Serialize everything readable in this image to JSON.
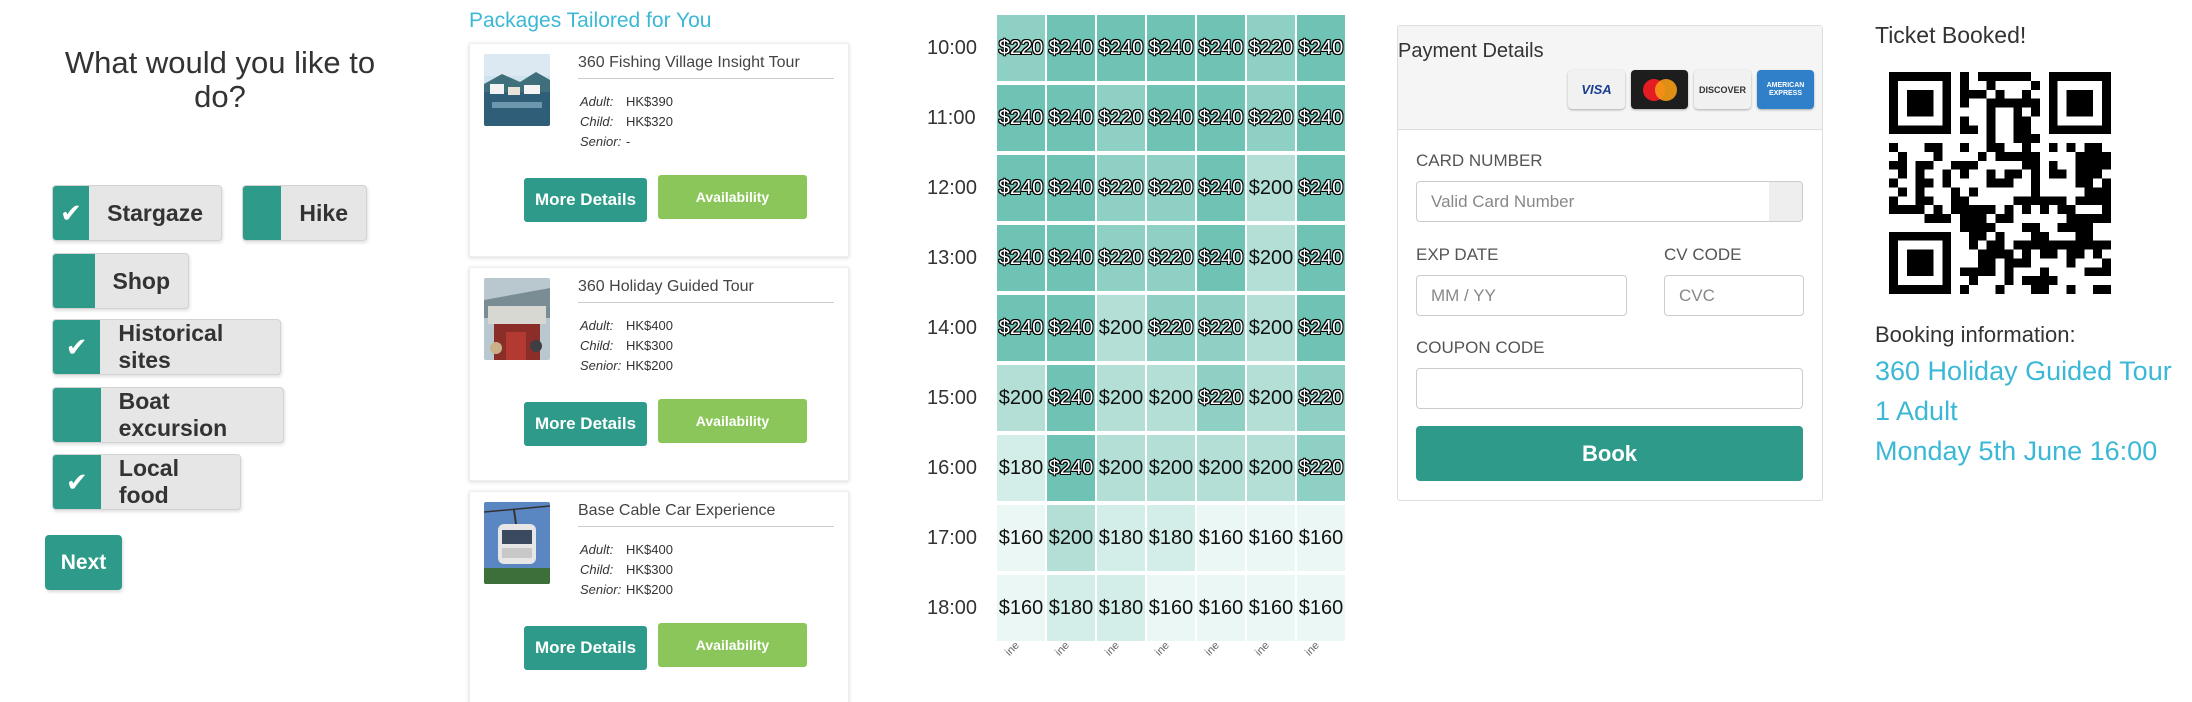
{
  "activities": {
    "question": "What would you like to do?",
    "items": [
      {
        "label": "Stargaze",
        "checked": true
      },
      {
        "label": "Hike",
        "checked": false
      },
      {
        "label": "Shop",
        "checked": false
      },
      {
        "label": "Historical sites",
        "checked": true
      },
      {
        "label": "Boat excursion",
        "checked": false
      },
      {
        "label": "Local food",
        "checked": true
      }
    ],
    "next_label": "Next"
  },
  "packages": {
    "title": "Packages Tailored for You",
    "cards": [
      {
        "name": "360 Fishing Village Insight Tour",
        "prices": [
          {
            "label": "Adult:",
            "value": "HK$390"
          },
          {
            "label": "Child:",
            "value": "HK$320"
          },
          {
            "label": "Senior:",
            "value": "-"
          }
        ],
        "more_label": "More Details",
        "avail_label": "Availability"
      },
      {
        "name": "360 Holiday Guided Tour",
        "prices": [
          {
            "label": "Adult:",
            "value": "HK$400"
          },
          {
            "label": "Child:",
            "value": "HK$300"
          },
          {
            "label": "Senior:",
            "value": "HK$200"
          }
        ],
        "more_label": "More Details",
        "avail_label": "Availability"
      },
      {
        "name": "Base Cable Car Experience",
        "prices": [
          {
            "label": "Adult:",
            "value": "HK$400"
          },
          {
            "label": "Child:",
            "value": "HK$300"
          },
          {
            "label": "Senior:",
            "value": "HK$200"
          }
        ],
        "more_label": "More Details",
        "avail_label": "Availability"
      }
    ]
  },
  "schedule": {
    "times": [
      "10:00",
      "11:00",
      "12:00",
      "13:00",
      "14:00",
      "15:00",
      "16:00",
      "17:00",
      "18:00"
    ],
    "day_labels": [
      "ine",
      "ine",
      "ine",
      "ine",
      "ine",
      "ine",
      "ine"
    ],
    "prices": [
      [
        "$220",
        "$240",
        "$240",
        "$240",
        "$240",
        "$220",
        "$240"
      ],
      [
        "$240",
        "$240",
        "$220",
        "$240",
        "$240",
        "$220",
        "$240"
      ],
      [
        "$240",
        "$240",
        "$220",
        "$220",
        "$240",
        "$200",
        "$240"
      ],
      [
        "$240",
        "$240",
        "$220",
        "$220",
        "$240",
        "$200",
        "$240"
      ],
      [
        "$240",
        "$240",
        "$200",
        "$220",
        "$220",
        "$200",
        "$240"
      ],
      [
        "$200",
        "$240",
        "$200",
        "$200",
        "$220",
        "$200",
        "$220"
      ],
      [
        "$180",
        "$240",
        "$200",
        "$200",
        "$200",
        "$200",
        "$220"
      ],
      [
        "$160",
        "$200",
        "$180",
        "$180",
        "$160",
        "$160",
        "$160"
      ],
      [
        "$160",
        "$180",
        "$180",
        "$160",
        "$160",
        "$160",
        "$160"
      ]
    ],
    "colors": {
      "240": "#6fc3b5",
      "220": "#8ed0c3",
      "200": "#b3dfd6",
      "180": "#d3eee8",
      "160": "#eaf7f4"
    }
  },
  "payment": {
    "title": "Payment Details",
    "card_icons": [
      "VISA",
      "MasterCard",
      "DISCOVER",
      "AMERICAN EXPRESS"
    ],
    "card_number_label": "CARD NUMBER",
    "card_number_placeholder": "Valid Card Number",
    "exp_label": "EXP DATE",
    "exp_placeholder": "MM / YY",
    "cv_label": "CV CODE",
    "cv_placeholder": "CVC",
    "coupon_label": "COUPON CODE",
    "coupon_value": "",
    "book_label": "Book"
  },
  "ticket": {
    "title": "Ticket Booked!",
    "booking_label": "Booking information:",
    "lines": [
      "360 Holiday Guided Tour",
      "1 Adult",
      "Monday 5th June 16:00"
    ]
  },
  "colors": {
    "primary": "#2e9b8a",
    "success": "#8bc65a",
    "accent_text": "#3bb8d6"
  }
}
